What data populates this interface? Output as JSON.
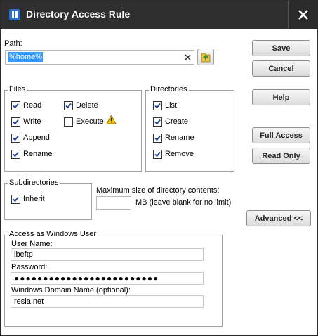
{
  "window": {
    "title": "Directory Access Rule",
    "close_symbol": "✕"
  },
  "path": {
    "label": "Path:",
    "value": "%home%",
    "clear_symbol": "✕"
  },
  "files": {
    "title": "Files",
    "options": [
      {
        "label": "Read",
        "checked": true
      },
      {
        "label": "Write",
        "checked": true
      },
      {
        "label": "Append",
        "checked": true
      },
      {
        "label": "Rename",
        "checked": true
      },
      {
        "label": "Delete",
        "checked": true
      },
      {
        "label": "Execute",
        "checked": false
      }
    ]
  },
  "directories": {
    "title": "Directories",
    "options": [
      {
        "label": "List",
        "checked": true
      },
      {
        "label": "Create",
        "checked": true
      },
      {
        "label": "Rename",
        "checked": true
      },
      {
        "label": "Remove",
        "checked": true
      }
    ]
  },
  "subdirectories": {
    "title": "Subdirectories",
    "inherit": {
      "label": "Inherit",
      "checked": true
    }
  },
  "max_size": {
    "label": "Maximum size of directory contents:",
    "unit_note": "MB (leave blank for no limit)",
    "value": ""
  },
  "windows_user": {
    "title": "Access as Windows User",
    "username_label": "User Name:",
    "username": "ibeftp",
    "password_label": "Password:",
    "password_mask": "●●●●●●●●●●●●●●●●●●●●●●●●●",
    "domain_label": "Windows Domain Name (optional):",
    "domain": "resia.net"
  },
  "buttons": {
    "save": "Save",
    "cancel": "Cancel",
    "help": "Help",
    "full_access": "Full Access",
    "read_only": "Read Only",
    "advanced": "Advanced <<"
  },
  "icons": {
    "app": "app-logo-icon",
    "browse": "folder-browse-icon",
    "warning": "warning-icon",
    "close": "close-icon"
  },
  "colors": {
    "titlebar": "#2f2f2f",
    "selection": "#3399ff",
    "warning": "#f2c400"
  }
}
